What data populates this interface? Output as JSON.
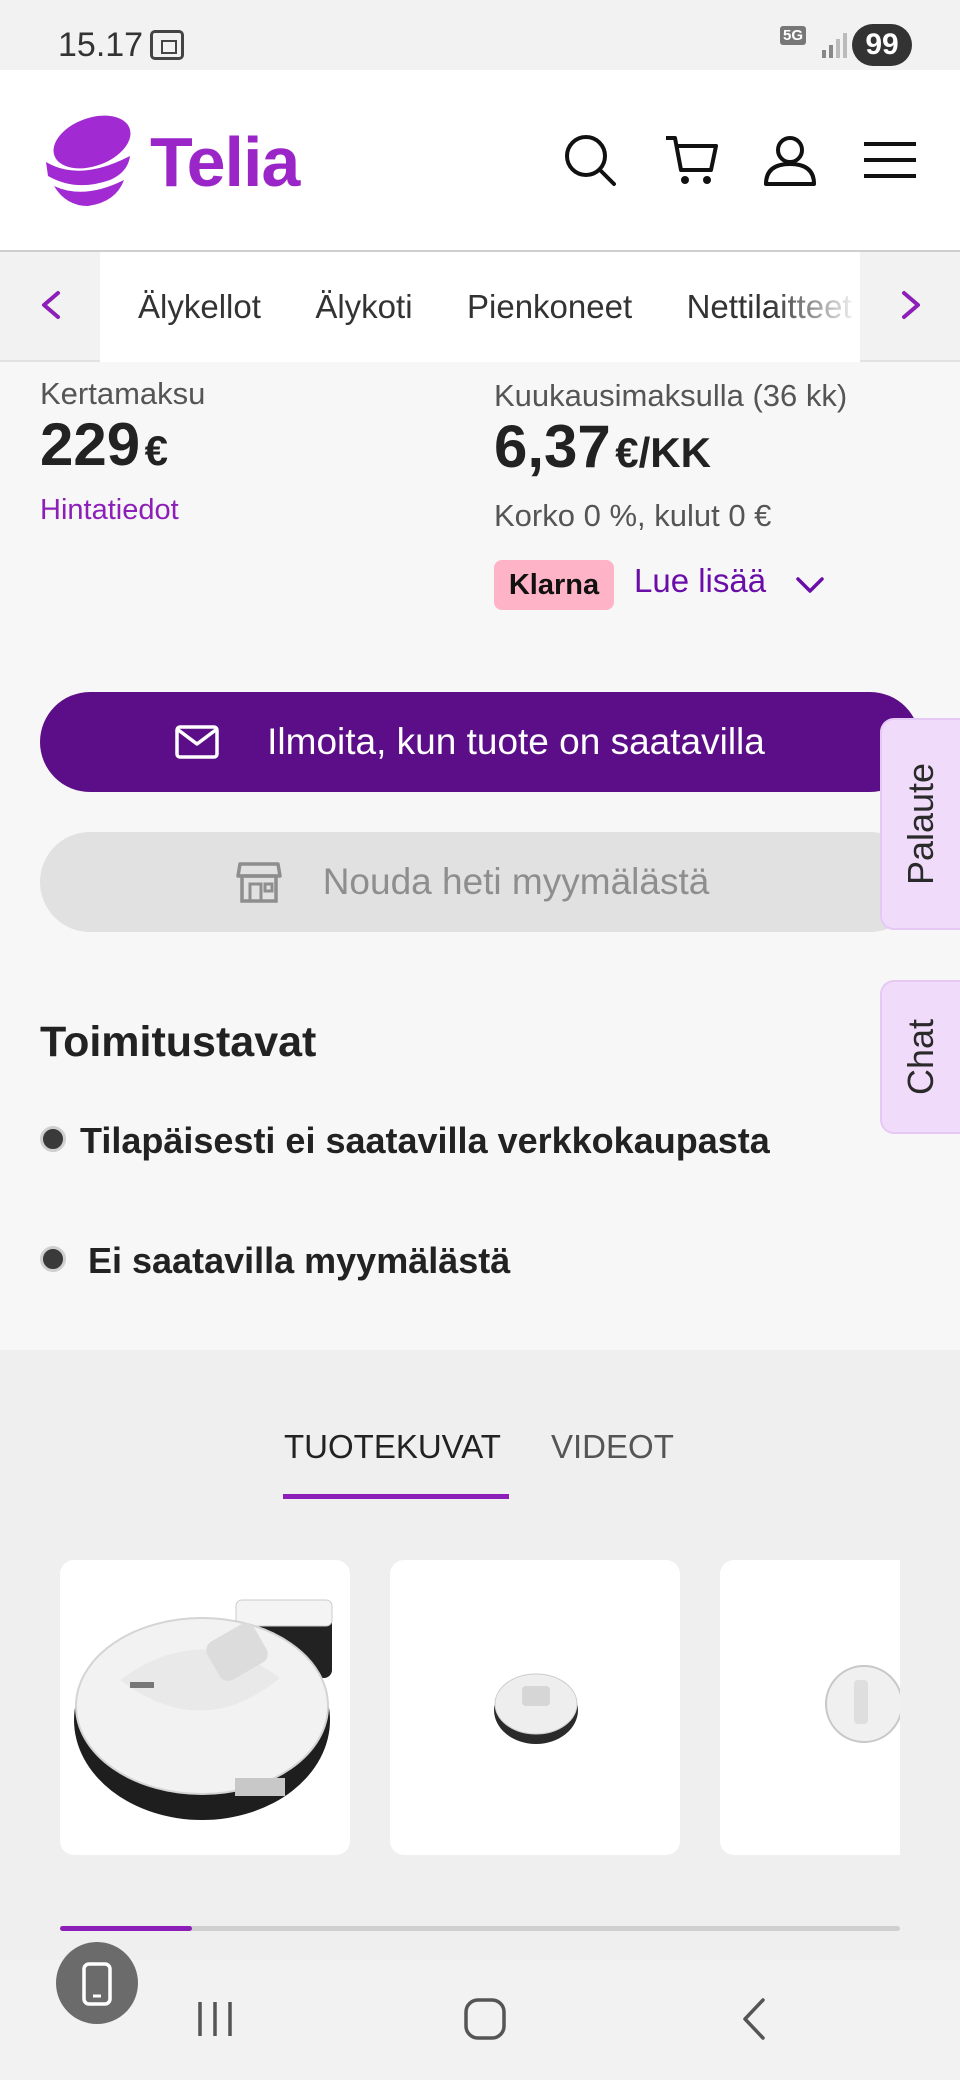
{
  "status_bar": {
    "time": "15.17",
    "network": "5G",
    "battery": "99"
  },
  "header": {
    "brand": "Telia"
  },
  "category_nav": {
    "items": [
      "Älykellot",
      "Älykoti",
      "Pienkoneet",
      "Nettilaitteet"
    ]
  },
  "price": {
    "one_time_label": "Kertamaksu",
    "one_time_amount": "229",
    "one_time_currency": "€",
    "price_info_link": "Hintatiedot",
    "monthly_label": "Kuukausimaksulla (36 kk)",
    "monthly_amount": "6,37",
    "monthly_unit": "€/KK",
    "monthly_terms": "Korko 0 %, kulut 0 €",
    "klarna_badge": "Klarna",
    "read_more": "Lue lisää"
  },
  "actions": {
    "notify_label": "Ilmoita, kun tuote on saatavilla",
    "pickup_label": "Nouda heti myymälästä"
  },
  "side_tabs": {
    "feedback": "Palaute",
    "chat": "Chat"
  },
  "delivery": {
    "title": "Toimitustavat",
    "items": [
      "Tilapäisesti ei saatavilla verkkokaupasta",
      "Ei saatavilla myymälästä"
    ]
  },
  "gallery": {
    "tabs": [
      "TUOTEKUVAT",
      "VIDEOT"
    ],
    "active_tab": "TUOTEKUVAT"
  },
  "colors": {
    "brand_purple": "#9b26c7",
    "button_purple": "#5b0e88",
    "klarna_pink": "#ffb3c7"
  }
}
